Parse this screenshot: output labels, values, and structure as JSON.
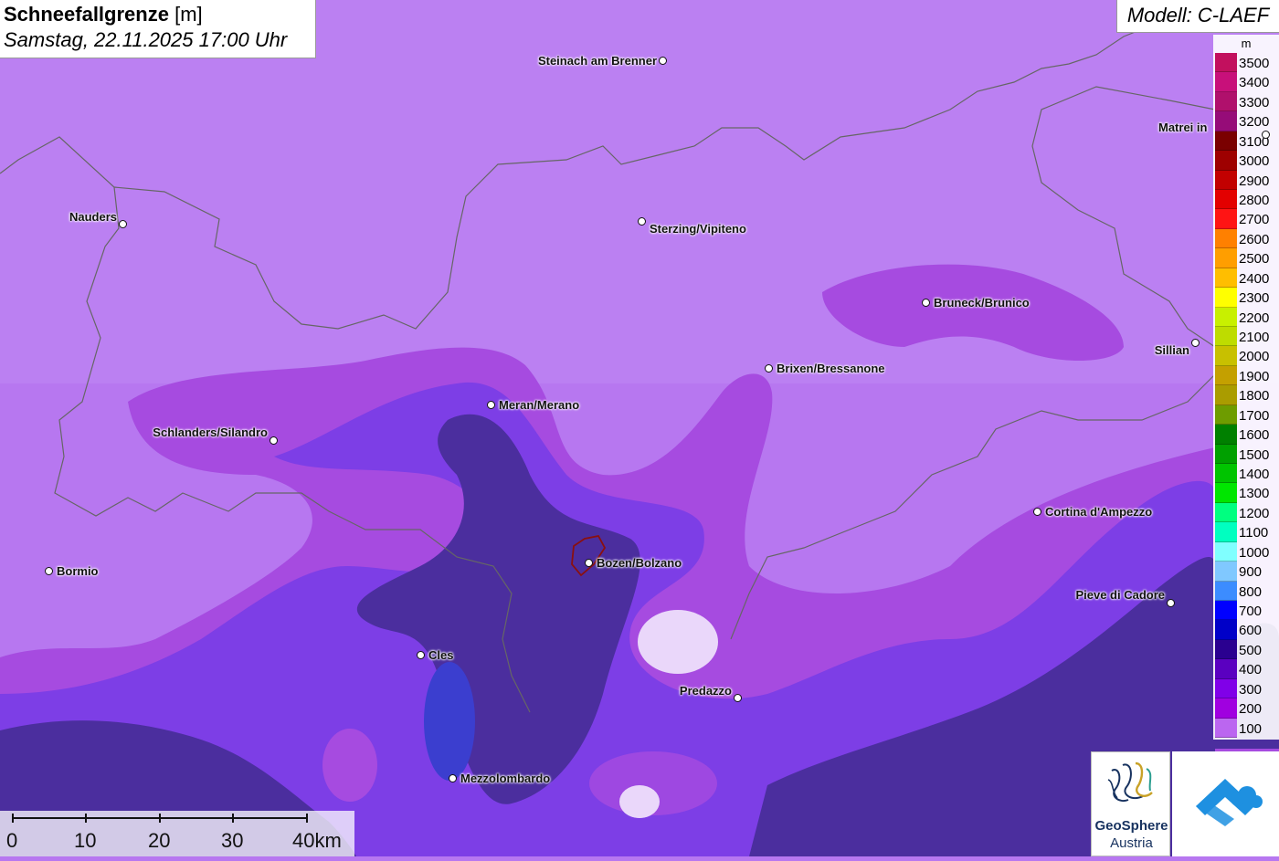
{
  "title": {
    "bold": "Schneefallgrenze",
    "unit": "[m]",
    "datetime": "Samstag, 22.11.2025 17:00 Uhr"
  },
  "model": "Modell: C-LAEF",
  "legend": {
    "unit": "m",
    "levels": [
      {
        "label": "3500",
        "color": "#c2105e"
      },
      {
        "label": "3400",
        "color": "#c8107a"
      },
      {
        "label": "3300",
        "color": "#b0106c"
      },
      {
        "label": "3200",
        "color": "#960c78"
      },
      {
        "label": "3100",
        "color": "#7a0000"
      },
      {
        "label": "3000",
        "color": "#9e0000"
      },
      {
        "label": "2900",
        "color": "#c20000"
      },
      {
        "label": "2800",
        "color": "#e30000"
      },
      {
        "label": "2700",
        "color": "#ff1414"
      },
      {
        "label": "2600",
        "color": "#ff8000"
      },
      {
        "label": "2500",
        "color": "#ff9e00"
      },
      {
        "label": "2400",
        "color": "#ffbe00"
      },
      {
        "label": "2300",
        "color": "#ffff00"
      },
      {
        "label": "2200",
        "color": "#c8f000"
      },
      {
        "label": "2100",
        "color": "#bedc00"
      },
      {
        "label": "2000",
        "color": "#c8c000"
      },
      {
        "label": "1900",
        "color": "#c4a000"
      },
      {
        "label": "1800",
        "color": "#aa9c00"
      },
      {
        "label": "1700",
        "color": "#6e9c00"
      },
      {
        "label": "1600",
        "color": "#008000"
      },
      {
        "label": "1500",
        "color": "#00a000"
      },
      {
        "label": "1400",
        "color": "#00c400"
      },
      {
        "label": "1300",
        "color": "#00e600"
      },
      {
        "label": "1200",
        "color": "#00ff80"
      },
      {
        "label": "1100",
        "color": "#00ffc0"
      },
      {
        "label": "1000",
        "color": "#80ffff"
      },
      {
        "label": "900",
        "color": "#80c8ff"
      },
      {
        "label": "800",
        "color": "#3c8cff"
      },
      {
        "label": "700",
        "color": "#0000ff"
      },
      {
        "label": "600",
        "color": "#0000c8"
      },
      {
        "label": "500",
        "color": "#2a0090"
      },
      {
        "label": "400",
        "color": "#5a00c0"
      },
      {
        "label": "300",
        "color": "#8000e8"
      },
      {
        "label": "200",
        "color": "#a000e0"
      },
      {
        "label": "100",
        "color": "#bb66f0"
      }
    ]
  },
  "cities": [
    {
      "name": "Steinach am Brenner"
    },
    {
      "name": "Nauders"
    },
    {
      "name": "Sterzing/Vipiteno"
    },
    {
      "name": "Matrei in"
    },
    {
      "name": "Bruneck/Brunico"
    },
    {
      "name": "Sillian"
    },
    {
      "name": "Brixen/Bressanone"
    },
    {
      "name": "Meran/Merano"
    },
    {
      "name": "Schlanders/Silandro"
    },
    {
      "name": "Cortina d'Ampezzo"
    },
    {
      "name": "Bormio"
    },
    {
      "name": "Bozen/Bolzano"
    },
    {
      "name": "Pieve di Cadore"
    },
    {
      "name": "Cles"
    },
    {
      "name": "Predazzo"
    },
    {
      "name": "Mezzolombardo"
    }
  ],
  "scale": {
    "ticks": [
      "0",
      "10",
      "20",
      "30",
      "40km"
    ]
  },
  "logo": {
    "line1": "GeoSphere",
    "line2": "Austria"
  }
}
